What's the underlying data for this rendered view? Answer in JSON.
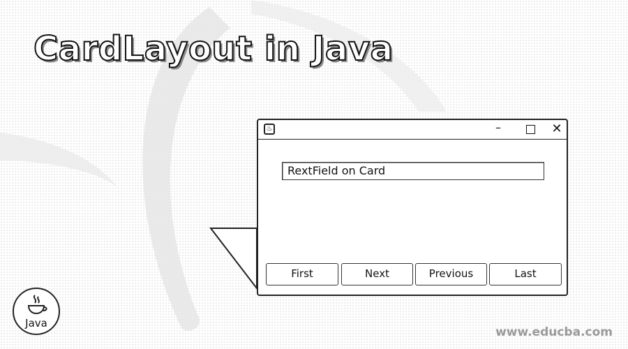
{
  "page": {
    "title": "CardLayout in Java",
    "watermark": "www.educba.com"
  },
  "window": {
    "icon": "java-app-icon",
    "minimize_glyph": "–",
    "close_glyph": "✕",
    "text_field": {
      "value": "RextField on Card"
    },
    "buttons": {
      "first": "First",
      "next": "Next",
      "previous": "Previous",
      "last": "Last"
    }
  },
  "logo": {
    "label": "Java",
    "icon": "java-coffee-cup-icon"
  },
  "colors": {
    "outline": "#222222",
    "background": "#ffffff",
    "watermark": "#9a9a9a"
  }
}
